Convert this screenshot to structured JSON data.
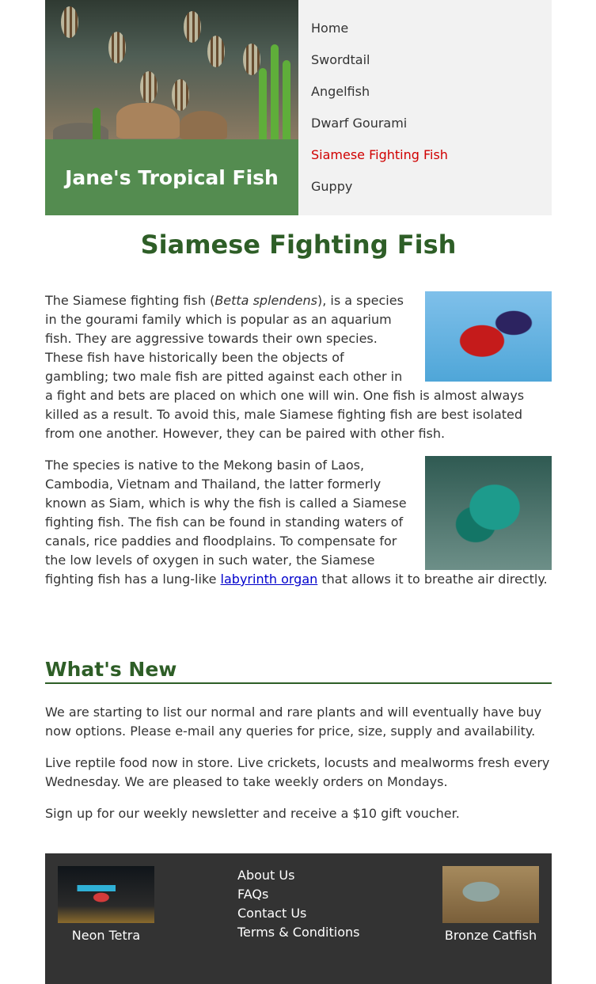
{
  "site": {
    "title": "Jane's Tropical Fish"
  },
  "nav": [
    {
      "label": "Home"
    },
    {
      "label": "Swordtail"
    },
    {
      "label": "Angelfish"
    },
    {
      "label": "Dwarf Gourami"
    },
    {
      "label": "Siamese Fighting Fish",
      "active": true
    },
    {
      "label": "Guppy"
    }
  ],
  "page": {
    "title": "Siamese Fighting Fish"
  },
  "article": {
    "p1_pre": "The Siamese fighting fish (",
    "p1_italic": "Betta splendens",
    "p1_post": "), is a species in the gourami family which is popular as an aquarium fish. They are aggressive towards their own species. These fish have historically been the objects of gambling; two male fish are pitted against each other in a fight and bets are placed on which one will win. One fish is almost always killed as a result. To avoid this, male Siamese fighting fish are best isolated from one another. However, they can be paired with other fish.",
    "p2_pre": "The species is native to the Mekong basin of Laos, Cambodia, Vietnam and Thailand, the latter formerly known as Siam, which is why the fish is called a Siamese fighting fish. The fish can be found in standing waters of canals, rice paddies and floodplains. To compensate for the low levels of oxygen in such water, the Siamese fighting fish has a lung-like ",
    "p2_link": "labyrinth organ",
    "p2_post": " that allows it to breathe air directly."
  },
  "news": {
    "heading": "What's New",
    "items": [
      "We are starting to list our normal and rare plants and will eventually have buy now options. Please e-mail any queries for price, size, supply and availability.",
      "Live reptile food now in store. Live crickets, locusts and mealworms fresh every Wednesday. We are pleased to take weekly orders on Mondays.",
      "Sign up for our weekly newsletter and receive a $10 gift voucher."
    ]
  },
  "footer": {
    "left_caption": "Neon Tetra",
    "right_caption": "Bronze Catfish",
    "links": [
      "About Us",
      "FAQs",
      "Contact Us",
      "Terms & Conditions"
    ]
  },
  "colors": {
    "brand_green": "#548c50",
    "heading_green": "#2e5e27",
    "active_nav": "#d00000",
    "footer_bg": "#333333",
    "nav_bg": "#f2f2f2"
  }
}
